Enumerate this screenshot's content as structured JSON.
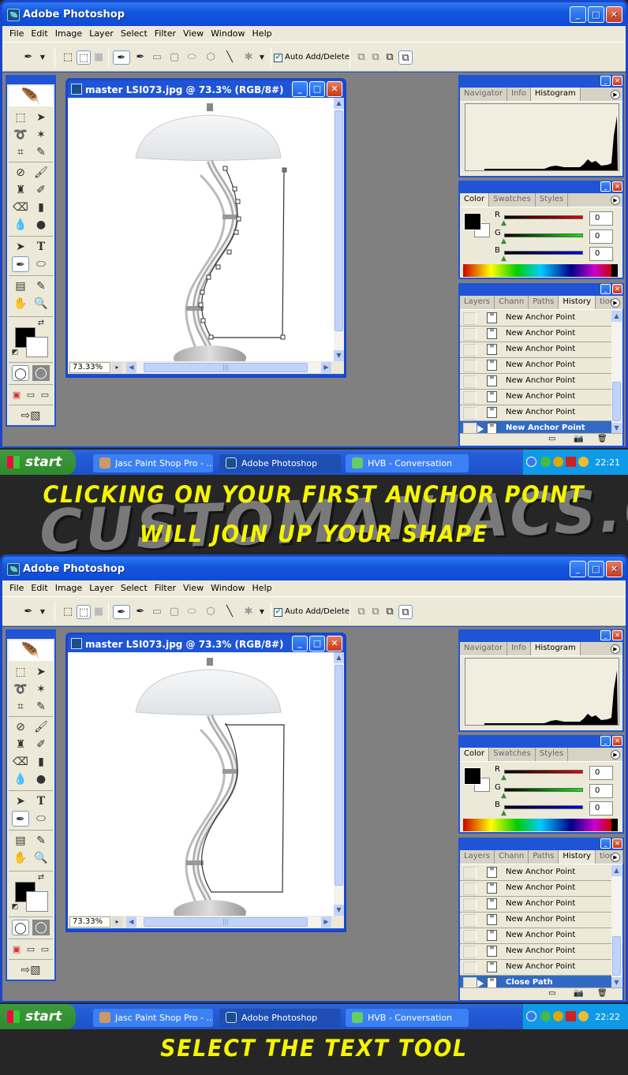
{
  "screens": [
    {
      "app_title": "Adobe Photoshop",
      "menu": [
        "File",
        "Edit",
        "Image",
        "Layer",
        "Select",
        "Filter",
        "View",
        "Window",
        "Help"
      ],
      "options": {
        "auto_add_delete_label": "Auto Add/Delete",
        "auto_add_delete_checked": true
      },
      "document": {
        "title": "master LSI073.jpg @ 73.3% (RGB/8#)",
        "zoom": "73.33%",
        "path_closed": false
      },
      "panels": {
        "histogram_tabs": [
          "Navigator",
          "Info",
          "Histogram"
        ],
        "color_tabs": [
          "Color",
          "Swatches",
          "Styles"
        ],
        "color": {
          "r_label": "R",
          "g_label": "G",
          "b_label": "B",
          "r": "0",
          "g": "0",
          "b": "0"
        },
        "history_tabs": [
          "Layers",
          "Chann",
          "Paths",
          "History",
          "tions"
        ],
        "history": [
          "New Anchor Point",
          "New Anchor Point",
          "New Anchor Point",
          "New Anchor Point",
          "New Anchor Point",
          "New Anchor Point",
          "New Anchor Point",
          "New Anchor Point"
        ],
        "history_selected": "New Anchor Point"
      },
      "taskbar": {
        "start": "start",
        "tasks": [
          "Jasc Paint Shop Pro - ...",
          "Adobe Photoshop",
          "HVB - Conversation"
        ],
        "clock": "22:21"
      }
    },
    {
      "app_title": "Adobe Photoshop",
      "menu": [
        "File",
        "Edit",
        "Image",
        "Layer",
        "Select",
        "Filter",
        "View",
        "Window",
        "Help"
      ],
      "options": {
        "auto_add_delete_label": "Auto Add/Delete",
        "auto_add_delete_checked": true
      },
      "document": {
        "title": "master LSI073.jpg @ 73.3% (RGB/8#)",
        "zoom": "73.33%",
        "path_closed": true
      },
      "panels": {
        "histogram_tabs": [
          "Navigator",
          "Info",
          "Histogram"
        ],
        "color_tabs": [
          "Color",
          "Swatches",
          "Styles"
        ],
        "color": {
          "r_label": "R",
          "g_label": "G",
          "b_label": "B",
          "r": "0",
          "g": "0",
          "b": "0"
        },
        "history_tabs": [
          "Layers",
          "Chann",
          "Paths",
          "History",
          "tions"
        ],
        "history": [
          "New Anchor Point",
          "New Anchor Point",
          "New Anchor Point",
          "New Anchor Point",
          "New Anchor Point",
          "New Anchor Point",
          "New Anchor Point",
          "Close Path"
        ],
        "history_selected": "Close Path"
      },
      "taskbar": {
        "start": "start",
        "tasks": [
          "Jasc Paint Shop Pro - ...",
          "Adobe Photoshop",
          "HVB - Conversation"
        ],
        "clock": "22:22"
      }
    }
  ],
  "captions": {
    "caption1_line1": "CLICKING ON YOUR FIRST ANCHOR POINT",
    "caption1_line2": "WILL JOIN UP YOUR SHAPE",
    "caption2": "SELECT THE TEXT TOOL",
    "watermark": "CUSTOMANIACS.ORG"
  },
  "colors": {
    "caption_yellow": "#f5f500",
    "xp_blue": "#1f54d6",
    "selection_blue": "#316ac5"
  }
}
